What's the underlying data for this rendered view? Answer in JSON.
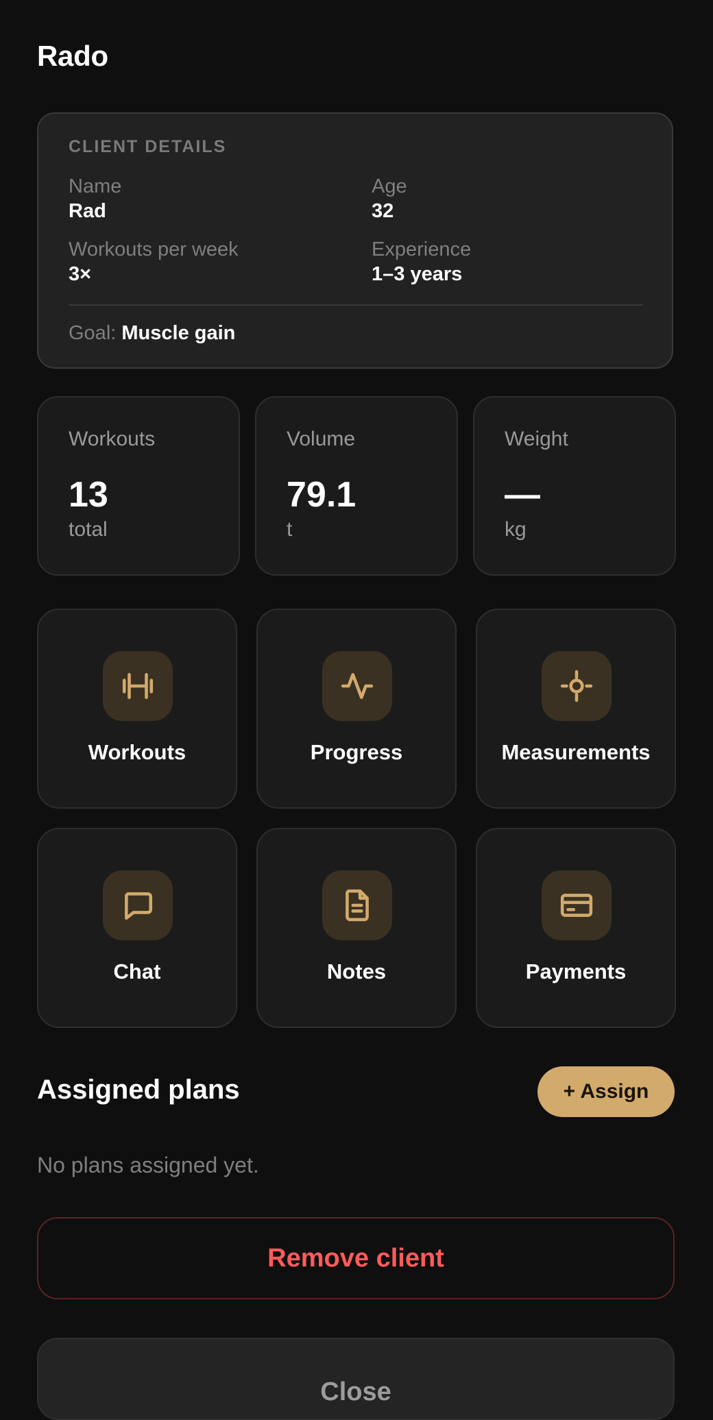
{
  "header": {
    "title": "Rado"
  },
  "client_details": {
    "section_label": "CLIENT DETAILS",
    "name_label": "Name",
    "name_value": "Rad",
    "age_label": "Age",
    "age_value": "32",
    "workouts_label": "Workouts per week",
    "workouts_value": "3×",
    "experience_label": "Experience",
    "experience_value": "1–3 years",
    "goal_label": "Goal:",
    "goal_value": "Muscle gain"
  },
  "stats": [
    {
      "label": "Workouts",
      "value": "13",
      "unit": "total"
    },
    {
      "label": "Volume",
      "value": "79.1",
      "unit": "t"
    },
    {
      "label": "Weight",
      "value": "—",
      "unit": "kg"
    }
  ],
  "actions": [
    {
      "label": "Workouts",
      "icon": "dumbbell-icon"
    },
    {
      "label": "Progress",
      "icon": "activity-icon"
    },
    {
      "label": "Measurements",
      "icon": "crosshair-icon"
    },
    {
      "label": "Chat",
      "icon": "chat-bubble-icon"
    },
    {
      "label": "Notes",
      "icon": "document-icon"
    },
    {
      "label": "Payments",
      "icon": "credit-card-icon"
    }
  ],
  "plans": {
    "title": "Assigned plans",
    "assign_label": "+ Assign",
    "empty_text": "No plans assigned yet."
  },
  "buttons": {
    "remove_label": "Remove client",
    "close_label": "Close"
  },
  "colors": {
    "accent": "#d2aa6c",
    "danger": "#ff5b5b",
    "background": "#0f0f0f"
  }
}
